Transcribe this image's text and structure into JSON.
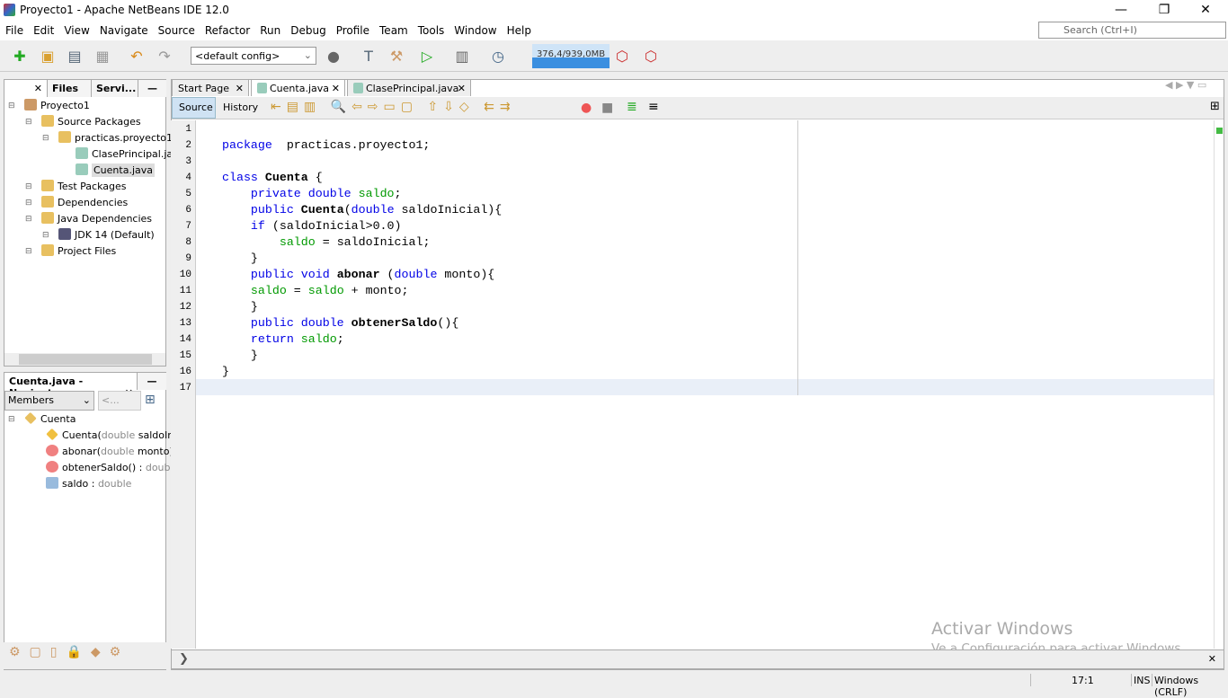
{
  "window": {
    "title": "Proyecto1 - Apache NetBeans IDE 12.0",
    "minimize": "—",
    "maximize": "❐",
    "close": "✕"
  },
  "menu": [
    "File",
    "Edit",
    "View",
    "Navigate",
    "Source",
    "Refactor",
    "Run",
    "Debug",
    "Profile",
    "Team",
    "Tools",
    "Window",
    "Help"
  ],
  "search": {
    "placeholder": "Search (Ctrl+I)"
  },
  "toolbar": {
    "config": "<default config>",
    "memory": "376,4/939,0MB"
  },
  "projects": {
    "tabs": [
      "Files",
      "Servi..."
    ],
    "tree": [
      {
        "label": "Proyecto1",
        "level": 0,
        "icon": "project-icon",
        "color": "#c96"
      },
      {
        "label": "Source Packages",
        "level": 1,
        "icon": "folder-icon",
        "color": "#e8c060"
      },
      {
        "label": "practicas.proyecto1",
        "level": 2,
        "icon": "package-icon",
        "color": "#e8c060"
      },
      {
        "label": "ClasePrincipal.java",
        "level": 3,
        "icon": "java-file-icon",
        "color": "#9cb"
      },
      {
        "label": "Cuenta.java",
        "level": 3,
        "icon": "java-file-icon",
        "color": "#9cb",
        "selected": true
      },
      {
        "label": "Test Packages",
        "level": 1,
        "icon": "folder-icon",
        "color": "#e8c060"
      },
      {
        "label": "Dependencies",
        "level": 1,
        "icon": "folder-icon",
        "color": "#e8c060"
      },
      {
        "label": "Java Dependencies",
        "level": 1,
        "icon": "folder-icon",
        "color": "#e8c060"
      },
      {
        "label": "JDK 14 (Default)",
        "level": 2,
        "icon": "jdk-icon",
        "color": "#557"
      },
      {
        "label": "Project Files",
        "level": 1,
        "icon": "folder-icon",
        "color": "#e8c060"
      }
    ]
  },
  "navigator": {
    "title": "Cuenta.java - Navigat...",
    "filter": "Members",
    "filter2": "<...",
    "items": [
      {
        "name": "Cuenta",
        "type": "",
        "level": 0,
        "icon": "class-icon"
      },
      {
        "name": "Cuenta(",
        "type": "double",
        "rest": " saldoInici",
        "level": 1,
        "icon": "constructor-icon"
      },
      {
        "name": "abonar(",
        "type": "double",
        "rest": " monto)",
        "level": 1,
        "icon": "method-icon"
      },
      {
        "name": "obtenerSaldo() : ",
        "type": "double",
        "rest": "",
        "level": 1,
        "icon": "method-icon"
      },
      {
        "name": "saldo : ",
        "type": "double",
        "rest": "",
        "level": 1,
        "icon": "field-icon"
      }
    ]
  },
  "editor": {
    "tabs": [
      "Start Page",
      "Cuenta.java",
      "ClasePrincipal.java"
    ],
    "active_tab": 1,
    "source": "Source",
    "history": "History",
    "lines": [
      [],
      [
        [
          "kw",
          "package"
        ],
        [
          "",
          "  practicas.proyecto1;"
        ]
      ],
      [],
      [
        [
          "kw",
          "class"
        ],
        [
          "",
          " "
        ],
        [
          "bd",
          "Cuenta"
        ],
        [
          "",
          " {"
        ]
      ],
      [
        [
          "",
          "    "
        ],
        [
          "kw",
          "private double"
        ],
        [
          "",
          " "
        ],
        [
          "fd",
          "saldo"
        ],
        [
          "",
          ";"
        ]
      ],
      [
        [
          "",
          "    "
        ],
        [
          "kw",
          "public"
        ],
        [
          "",
          " "
        ],
        [
          "bd",
          "Cuenta"
        ],
        [
          "",
          "("
        ],
        [
          "kw",
          "double"
        ],
        [
          "",
          " saldoInicial){"
        ]
      ],
      [
        [
          "",
          "    "
        ],
        [
          "kw",
          "if"
        ],
        [
          "",
          " (saldoInicial>0.0)"
        ]
      ],
      [
        [
          "",
          "        "
        ],
        [
          "fd",
          "saldo"
        ],
        [
          "",
          " = saldoInicial;"
        ]
      ],
      [
        [
          "",
          "    }"
        ]
      ],
      [
        [
          "",
          "    "
        ],
        [
          "kw",
          "public void"
        ],
        [
          "",
          " "
        ],
        [
          "bd",
          "abonar"
        ],
        [
          "",
          " ("
        ],
        [
          "kw",
          "double"
        ],
        [
          "",
          " monto){"
        ]
      ],
      [
        [
          "",
          "    "
        ],
        [
          "fd",
          "saldo"
        ],
        [
          "",
          " = "
        ],
        [
          "fd",
          "saldo"
        ],
        [
          "",
          " + monto;"
        ]
      ],
      [
        [
          "",
          "    }"
        ]
      ],
      [
        [
          "",
          "    "
        ],
        [
          "kw",
          "public double"
        ],
        [
          "",
          " "
        ],
        [
          "bd",
          "obtenerSaldo"
        ],
        [
          "",
          "(){"
        ]
      ],
      [
        [
          "",
          "    "
        ],
        [
          "kw",
          "return"
        ],
        [
          "",
          " "
        ],
        [
          "fd",
          "saldo"
        ],
        [
          "",
          ";"
        ]
      ],
      [
        [
          "",
          "    }"
        ]
      ],
      [
        [
          "",
          "}"
        ]
      ],
      []
    ]
  },
  "watermark": {
    "title": "Activar Windows",
    "subtitle": "Ve a Configuración para activar Windows."
  },
  "status": {
    "position": "17:1",
    "mode": "INS",
    "line_endings": "Windows (CRLF)"
  }
}
